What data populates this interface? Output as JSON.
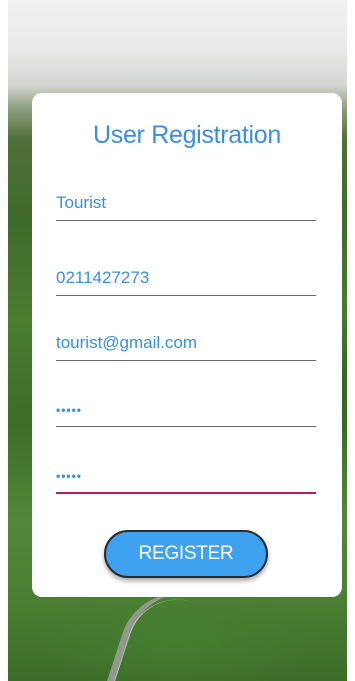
{
  "form": {
    "title": "User Registration",
    "fields": [
      {
        "name": "username",
        "value": "Tourist",
        "masked": false
      },
      {
        "name": "phone",
        "value": "0211427273",
        "masked": false
      },
      {
        "name": "email",
        "value": "tourist@gmail.com",
        "masked": false
      },
      {
        "name": "password",
        "value": "•••••",
        "masked": true
      },
      {
        "name": "confirm-password",
        "value": "•••••",
        "masked": true
      }
    ],
    "submit_label": "REGISTER"
  },
  "colors": {
    "accent": "#3b8ee0",
    "button": "#3ea2f0",
    "active_underline": "#c2185b"
  }
}
